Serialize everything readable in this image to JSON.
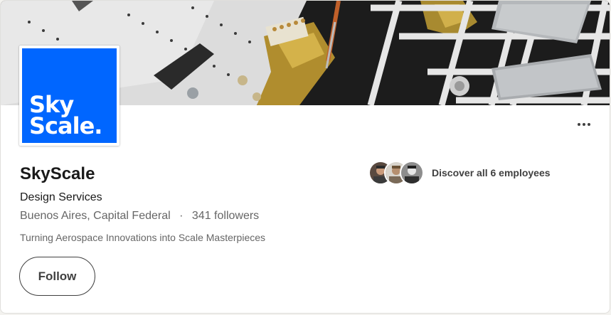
{
  "company": {
    "logo_line1": "Sky",
    "logo_line2": "Scale.",
    "logo_color": "#0066ff",
    "name": "SkyScale",
    "industry": "Design Services",
    "location": "Buenos Aires, Capital Federal",
    "separator": "·",
    "followers": "341 followers",
    "tagline": "Turning Aerospace Innovations into Scale Masterpieces"
  },
  "actions": {
    "follow_label": "Follow",
    "more_icon": "more-horizontal-icon"
  },
  "employees": {
    "label": "Discover all 6 employees",
    "avatar_count": 3
  },
  "banner": {
    "subject": "scale model parts on sprue"
  }
}
